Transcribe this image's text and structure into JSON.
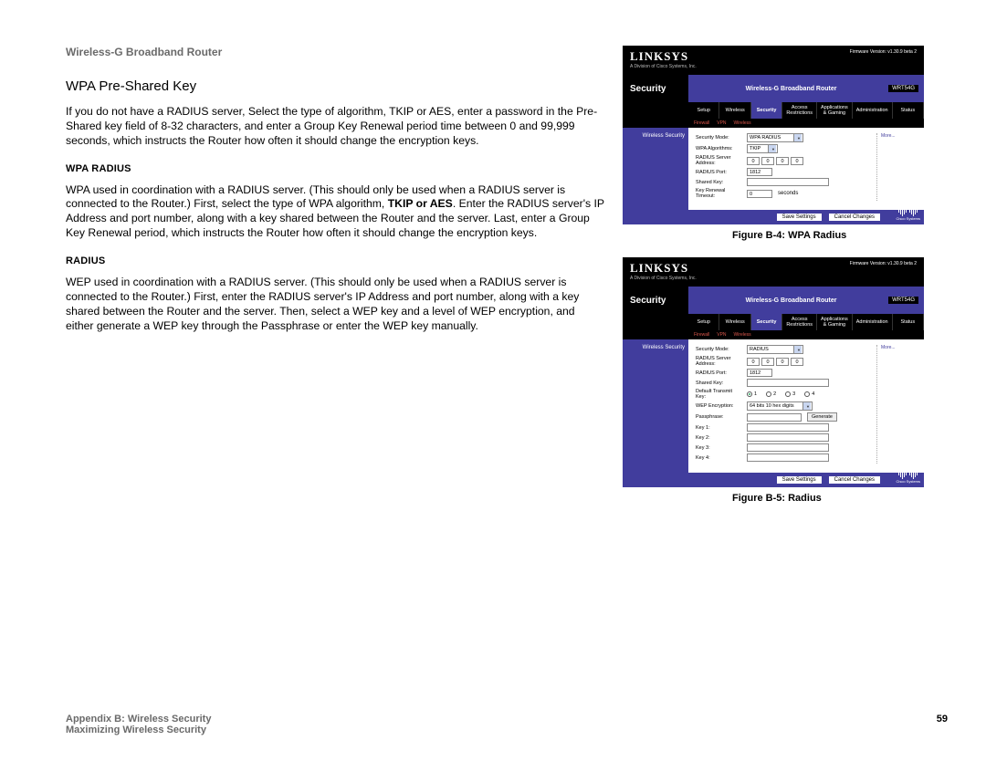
{
  "doc_title": "Wireless-G Broadband Router",
  "sections": {
    "psk_title": "WPA Pre-Shared Key",
    "psk_body": "If you do not have a RADIUS server, Select the type of algorithm, TKIP or AES, enter a password in the Pre-Shared key field of 8-32 characters, and enter a Group Key Renewal period time between 0 and 99,999 seconds, which instructs the Router how often it should change the encryption keys.",
    "wpar_title": "WPA RADIUS",
    "wpar_body_pre": "WPA used in coordination with a RADIUS server. (This should only be used when a RADIUS server is connected to the Router.) First, select the type of WPA algorithm, ",
    "wpar_bold": "TKIP or AES",
    "wpar_body_post": ". Enter the RADIUS server's IP Address and port number, along with a key shared between the Router and the server. Last, enter a Group Key Renewal period, which instructs the Router how often it should change the encryption keys.",
    "radius_title": "RADIUS",
    "radius_body": "WEP used in coordination with a RADIUS server. (This should only be used when a RADIUS server is connected to the Router.) First, enter the RADIUS server's IP Address and port number, along with a key shared between the Router and the server. Then, select a WEP key and a level of WEP encryption, and either generate a WEP key through the Passphrase or enter the WEP key manually."
  },
  "figures": {
    "b4_caption": "Figure B-4: WPA Radius",
    "b5_caption": "Figure B-5: Radius"
  },
  "shot_common": {
    "brand": "LINKSYS",
    "brand_sub": "A Division of Cisco Systems, Inc.",
    "fw": "Firmware Version: v1.30.9 beta 2",
    "banner_mid": "Wireless-G Broadband Router",
    "model": "WRT54G",
    "security": "Security",
    "tabs": [
      "Setup",
      "Wireless",
      "Security",
      "Access Restrictions",
      "Applications & Gaming",
      "Administration",
      "Status"
    ],
    "subtabs": [
      "Firewall",
      "VPN",
      "Wireless"
    ],
    "side_label": "Wireless Security",
    "more": "More...",
    "save": "Save Settings",
    "cancel": "Cancel Changes",
    "cisco": "Cisco Systems"
  },
  "shot_b4": {
    "mode_label": "Security Mode:",
    "mode_value": "WPA RADIUS",
    "algo_label": "WPA Algorithms:",
    "algo_value": "TKIP",
    "addr_label": "RADIUS Server Address:",
    "ip": [
      "0",
      "0",
      "0",
      "0"
    ],
    "port_label": "RADIUS Port:",
    "port_value": "1812",
    "shared_label": "Shared Key:",
    "renew_label": "Key Renewal Timeout:",
    "renew_value": "0",
    "seconds": "seconds"
  },
  "shot_b5": {
    "mode_label": "Security Mode:",
    "mode_value": "RADIUS",
    "addr_label": "RADIUS Server Address:",
    "ip": [
      "0",
      "0",
      "0",
      "0"
    ],
    "port_label": "RADIUS Port:",
    "port_value": "1812",
    "shared_label": "Shared Key:",
    "dtk_label": "Default Transmit Key:",
    "dtk_opts": [
      "1",
      "2",
      "3",
      "4"
    ],
    "enc_label": "WEP Encryption:",
    "enc_value": "64 bits 10 hex digits",
    "pass_label": "Passphrase:",
    "generate": "Generate",
    "k1": "Key 1:",
    "k2": "Key 2:",
    "k3": "Key 3:",
    "k4": "Key 4:"
  },
  "footer": {
    "line1": "Appendix B: Wireless Security",
    "line2": "Maximizing Wireless Security",
    "page": "59"
  }
}
